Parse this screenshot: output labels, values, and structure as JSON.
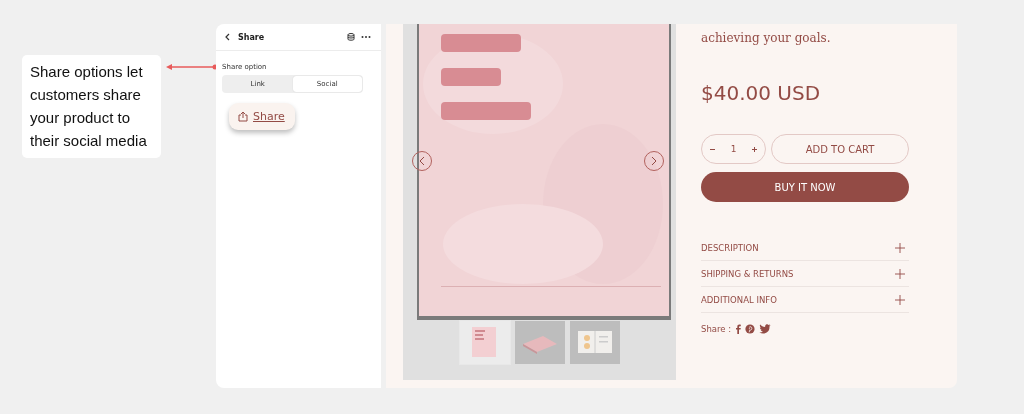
{
  "callout": {
    "text": "Share options let customers share your product to their social media"
  },
  "editor": {
    "title": "Share",
    "setting_label": "Share option",
    "segments": [
      {
        "label": "Link",
        "selected": false
      },
      {
        "label": "Social",
        "selected": true
      }
    ],
    "preview_button": {
      "label": "Share"
    }
  },
  "product": {
    "image": {
      "kind": "picture"
    },
    "thumbnails": [
      {
        "kind": "picture",
        "selected": true
      },
      {
        "kind": "picture",
        "selected": false
      },
      {
        "kind": "picture",
        "selected": false
      }
    ],
    "description_tail": "achieving your goals.",
    "price": "$40.00 USD",
    "quantity": "1",
    "add_to_cart": "ADD TO CART",
    "buy_now": "BUY IT NOW",
    "accordions": [
      {
        "label": "DESCRIPTION",
        "expanded": false
      },
      {
        "label": "SHIPPING & RETURNS",
        "expanded": false
      },
      {
        "label": "ADDITIONAL INFO",
        "expanded": false
      }
    ],
    "share_label": "Share :"
  }
}
